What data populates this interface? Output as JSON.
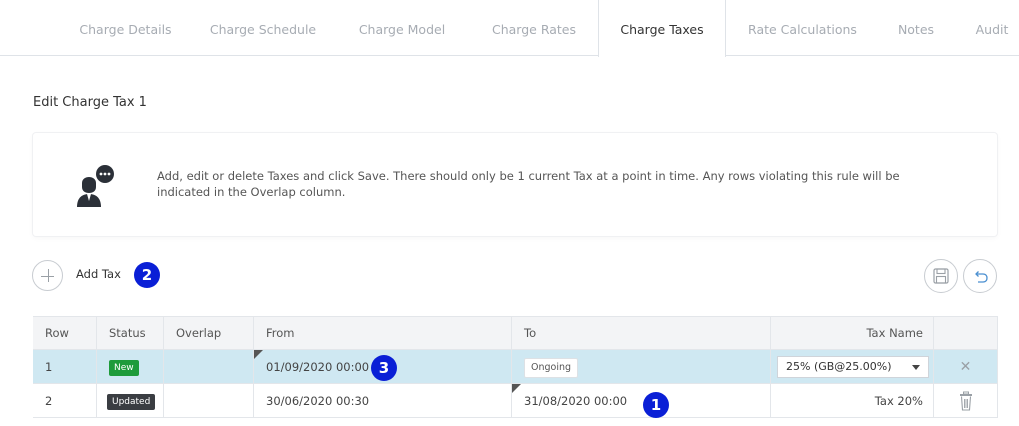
{
  "tabs": [
    {
      "label": "Charge Details"
    },
    {
      "label": "Charge Schedule"
    },
    {
      "label": "Charge Model"
    },
    {
      "label": "Charge Rates"
    },
    {
      "label": "Charge Taxes",
      "active": true
    },
    {
      "label": "Rate Calculations"
    },
    {
      "label": "Notes"
    },
    {
      "label": "Audit"
    }
  ],
  "section_title": "Edit Charge Tax 1",
  "info": {
    "text": "Add, edit or delete Taxes and click Save. There should only be 1 current Tax at a point in time. Any rows violating this rule will be indicated in the Overlap column.",
    "icon": "support-agent-icon"
  },
  "actions": {
    "add_label": "Add Tax",
    "save_icon": "save-icon",
    "undo_icon": "undo-icon"
  },
  "badges": {
    "b1": "1",
    "b2": "2",
    "b3": "3"
  },
  "table": {
    "headers": {
      "row": "Row",
      "status": "Status",
      "overlap": "Overlap",
      "from": "From",
      "to": "To",
      "tax_name": "Tax Name"
    },
    "rows": [
      {
        "row": "1",
        "status": "New",
        "overlap": "",
        "from": "01/09/2020 00:00",
        "to": "Ongoing",
        "tax_name": "25% (GB@25.00%)",
        "action_icon": "close-icon"
      },
      {
        "row": "2",
        "status": "Updated",
        "overlap": "",
        "from": "30/06/2020 00:30",
        "to": "31/08/2020 00:00",
        "tax_name": "Tax 20%",
        "action_icon": "trash-icon"
      }
    ]
  },
  "colors": {
    "badge": "#0a1fd6",
    "selected_row": "#cfe8f2",
    "status_new": "#1e9b3a",
    "status_updated": "#3a3d42"
  }
}
